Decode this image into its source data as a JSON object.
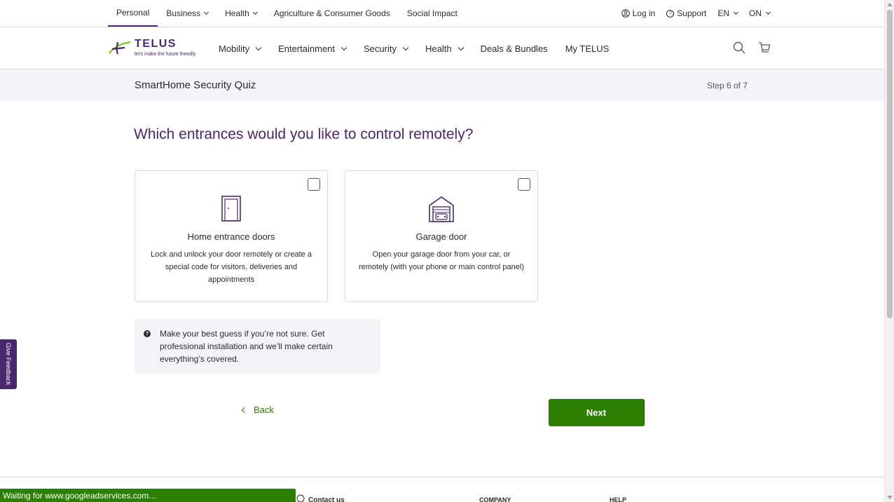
{
  "utility_nav": {
    "items": [
      {
        "label": "Personal",
        "active": true
      },
      {
        "label": "Business",
        "dropdown": true
      },
      {
        "label": "Health",
        "dropdown": true
      },
      {
        "label": "Agriculture & Consumer Goods"
      },
      {
        "label": "Social Impact"
      }
    ],
    "login": "Log in",
    "support": "Support",
    "language": "EN",
    "province": "ON"
  },
  "brand": {
    "name": "TELUS",
    "tagline": "let's make the future friendly",
    "color_purple": "#4b286d",
    "color_green": "#2b8000"
  },
  "main_nav": {
    "items": [
      {
        "label": "Mobility",
        "dropdown": true
      },
      {
        "label": "Entertainment",
        "dropdown": true
      },
      {
        "label": "Security",
        "dropdown": true
      },
      {
        "label": "Health",
        "dropdown": true
      },
      {
        "label": "Deals & Bundles"
      },
      {
        "label": "My TELUS"
      }
    ],
    "icons": [
      "search-icon",
      "cart-icon"
    ]
  },
  "quiz": {
    "title": "SmartHome Security Quiz",
    "step": "Step 6 of 7",
    "question": "Which entrances would you like to control remotely?",
    "options": [
      {
        "icon": "door-icon",
        "title": "Home entrance doors",
        "description": "Lock and unlock your door remotely or create a special code for visitors, deliveries and appointments",
        "checked": false
      },
      {
        "icon": "garage-icon",
        "title": "Garage door",
        "description": "Open your garage door from your car, or remotely (with your phone or main control panel)",
        "checked": false
      }
    ],
    "hint": "Make your best guess if you’re not sure. Get professional installation and we’ll make certain everything’s covered.",
    "back_label": "Back",
    "next_label": "Next"
  },
  "footer": {
    "contact": "Contact us",
    "company": "COMPANY",
    "help": "HELP"
  },
  "feedback_tab": "Give Feedback",
  "status_bar": "Waiting for www.googleadservices.com..."
}
